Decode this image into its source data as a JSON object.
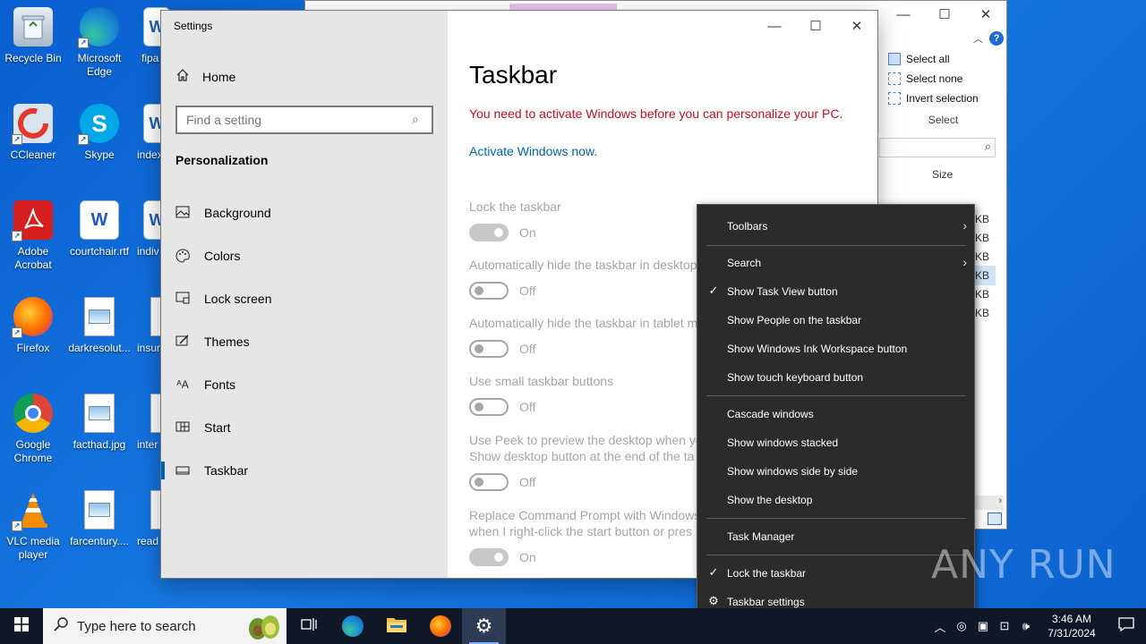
{
  "desktop": {
    "icons": [
      {
        "label": "Recycle Bin",
        "name": "recycle-bin-icon"
      },
      {
        "label": "Microsoft Edge",
        "name": "microsoft-edge-icon"
      },
      {
        "label": "fipa",
        "name": "word-document-icon"
      },
      {
        "label": "CCleaner",
        "name": "ccleaner-icon"
      },
      {
        "label": "Skype",
        "name": "skype-icon"
      },
      {
        "label": "index",
        "name": "word-document-icon"
      },
      {
        "label": "Adobe Acrobat",
        "name": "adobe-acrobat-icon"
      },
      {
        "label": "courtchair.rtf",
        "name": "word-document-icon"
      },
      {
        "label": "indiv",
        "name": "word-document-icon"
      },
      {
        "label": "Firefox",
        "name": "firefox-icon"
      },
      {
        "label": "darkresolut...",
        "name": "image-file-icon"
      },
      {
        "label": "insur",
        "name": "file-icon"
      },
      {
        "label": "Google Chrome",
        "name": "google-chrome-icon"
      },
      {
        "label": "facthad.jpg",
        "name": "image-file-icon"
      },
      {
        "label": "inter",
        "name": "file-icon"
      },
      {
        "label": "VLC media player",
        "name": "vlc-icon"
      },
      {
        "label": "farcentury....",
        "name": "image-file-icon"
      },
      {
        "label": "read",
        "name": "file-icon"
      }
    ]
  },
  "explorer": {
    "ribbon": {
      "select_all": "Select all",
      "select_none": "Select none",
      "invert_selection": "Invert selection",
      "group_label": "Select"
    },
    "size_header": "Size",
    "size_values": [
      "KB",
      "KB",
      "KB",
      "KB",
      "KB",
      "KB"
    ]
  },
  "settings": {
    "window_title": "Settings",
    "home_label": "Home",
    "search_placeholder": "Find a setting",
    "section_title": "Personalization",
    "nav_items": [
      {
        "label": "Background",
        "icon": "picture-icon"
      },
      {
        "label": "Colors",
        "icon": "palette-icon"
      },
      {
        "label": "Lock screen",
        "icon": "lock-screen-icon"
      },
      {
        "label": "Themes",
        "icon": "brush-icon"
      },
      {
        "label": "Fonts",
        "icon": "font-icon"
      },
      {
        "label": "Start",
        "icon": "start-icon"
      },
      {
        "label": "Taskbar",
        "icon": "taskbar-icon"
      }
    ],
    "page_title": "Taskbar",
    "activation_warning": "You need to activate Windows before you can personalize your PC.",
    "activate_link": "Activate Windows now.",
    "options": [
      {
        "label": "Lock the taskbar",
        "state": "On"
      },
      {
        "label": "Automatically hide the taskbar in desktop",
        "state": "Off"
      },
      {
        "label": "Automatically hide the taskbar in tablet m",
        "state": "Off"
      },
      {
        "label": "Use small taskbar buttons",
        "state": "Off"
      },
      {
        "label": "Use Peek to preview the desktop when yo",
        "label2": "Show desktop button at the end of the ta",
        "state": "Off"
      },
      {
        "label": "Replace Command Prompt with Windows",
        "label2": "when I right-click the start button or pres",
        "state": "On"
      }
    ]
  },
  "context_menu": {
    "toolbars": "Toolbars",
    "search": "Search",
    "show_task_view": "Show Task View button",
    "show_people": "Show People on the taskbar",
    "show_ink": "Show Windows Ink Workspace button",
    "show_touch_keyboard": "Show touch keyboard button",
    "cascade": "Cascade windows",
    "stacked": "Show windows stacked",
    "side_by_side": "Show windows side by side",
    "show_desktop": "Show the desktop",
    "task_manager": "Task Manager",
    "lock_taskbar": "Lock the taskbar",
    "taskbar_settings": "Taskbar settings"
  },
  "taskbar": {
    "search_placeholder": "Type here to search",
    "time": "3:46 AM",
    "date": "7/31/2024"
  },
  "watermark": "ANY RUN",
  "colors": {
    "accent": "#0063b1",
    "warning": "#c50f1f",
    "menu_bg": "#2b2b2b",
    "taskbar_bg": "#101828"
  }
}
